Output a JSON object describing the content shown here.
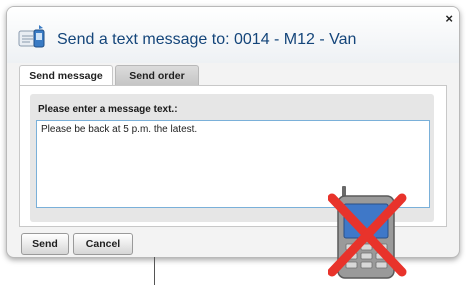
{
  "dialog": {
    "title": "Send a text message to: 0014 -  M12 - Van",
    "close_label": "×"
  },
  "tabs": [
    {
      "label": "Send message",
      "active": true
    },
    {
      "label": "Send order",
      "active": false
    }
  ],
  "form": {
    "prompt": "Please enter a message text.:",
    "message_value": "Please be back at 5 p.m. the latest."
  },
  "buttons": {
    "send": "Send",
    "cancel": "Cancel"
  },
  "colors": {
    "title_text": "#14457a",
    "field_border": "#7ab0d9",
    "cross": "#e8332b"
  },
  "icons": {
    "title_icon": "sms-message-icon",
    "overlay_icon": "mobile-phone-crossed-out-icon"
  }
}
